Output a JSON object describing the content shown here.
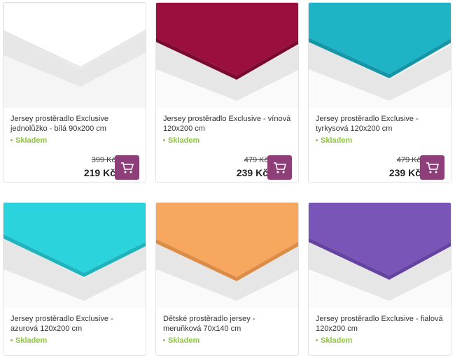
{
  "products": [
    {
      "title": "Jersey prostěradlo Exclusive jednolůžko - bílá 90x200 cm",
      "stock": "Skladem",
      "old_price": "399 Kč",
      "price": "219 Kč",
      "color": "#ffffff",
      "base_color": "#dddddd"
    },
    {
      "title": "Jersey prostěradlo Exclusive - vínová 120x200 cm",
      "stock": "Skladem",
      "old_price": "479 Kč",
      "price": "239 Kč",
      "color": "#9b0f3f",
      "base_color": "#7a0a30"
    },
    {
      "title": "Jersey prostěradlo Exclusive - tyrkysová 120x200 cm",
      "stock": "Skladem",
      "old_price": "479 Kč",
      "price": "239 Kč",
      "color": "#1fb3c6",
      "base_color": "#1596a7"
    },
    {
      "title": "Jersey prostěradlo Exclusive - azurová 120x200 cm",
      "stock": "Skladem",
      "color": "#2bd3dd",
      "base_color": "#1fb4bd"
    },
    {
      "title": "Dětské prostěradlo jersey - meruňková 70x140 cm",
      "stock": "Skladem",
      "color": "#f7a75e",
      "base_color": "#db8c47"
    },
    {
      "title": "Jersey prostěradlo Exclusive - fialová 120x200 cm",
      "stock": "Skladem",
      "color": "#7a55b8",
      "base_color": "#6444a0"
    }
  ]
}
